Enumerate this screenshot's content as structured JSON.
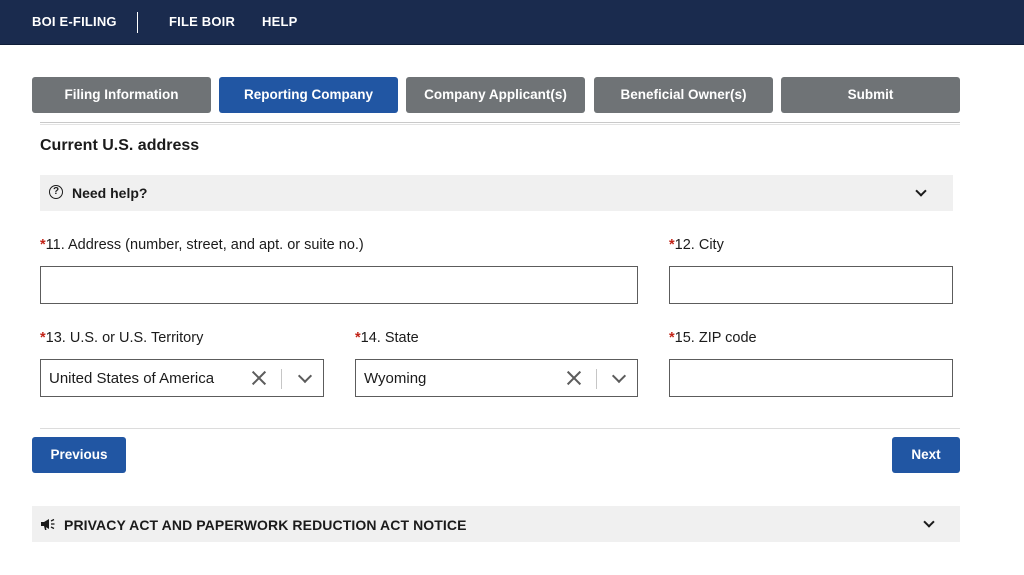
{
  "topbar": {
    "links": [
      "BOI E-FILING",
      "FILE BOIR",
      "HELP"
    ]
  },
  "steps": [
    {
      "label": "Filing Information",
      "active": false
    },
    {
      "label": "Reporting Company",
      "active": true
    },
    {
      "label": "Company Applicant(s)",
      "active": false
    },
    {
      "label": "Beneficial Owner(s)",
      "active": false
    },
    {
      "label": "Submit",
      "active": false
    }
  ],
  "section": {
    "title": "Current U.S. address",
    "help_label": "Need help?"
  },
  "fields": {
    "address": {
      "label": "11. Address (number, street, and apt. or suite no.)",
      "value": ""
    },
    "city": {
      "label": "12. City",
      "value": ""
    },
    "territory": {
      "label": "13. U.S. or U.S. Territory",
      "value": "United States of America"
    },
    "state": {
      "label": "14. State",
      "value": "Wyoming"
    },
    "zip": {
      "label": "15. ZIP code",
      "value": ""
    },
    "required_marker": "*"
  },
  "buttons": {
    "previous": "Previous",
    "next": "Next"
  },
  "privacy": {
    "label": "PRIVACY ACT AND PAPERWORK REDUCTION ACT NOTICE"
  },
  "colors": {
    "topbar": "#1a2b4e",
    "active_step": "#2156a3",
    "inactive_step": "#6f7376",
    "required": "#c22317"
  },
  "icons": {
    "help": "question-circle-icon",
    "clear": "close-icon",
    "expand": "chevron-down-icon",
    "privacy": "megaphone-icon"
  }
}
